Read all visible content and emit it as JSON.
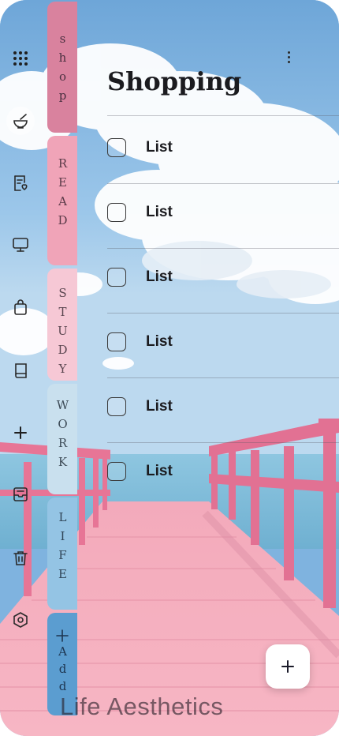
{
  "rail": {
    "items": [
      {
        "name": "apps-grid-icon"
      },
      {
        "name": "mortar-pestle-icon"
      },
      {
        "name": "reading-list-icon"
      },
      {
        "name": "monitor-icon"
      },
      {
        "name": "shopping-bag-icon"
      },
      {
        "name": "book-icon"
      },
      {
        "name": "add-icon"
      },
      {
        "name": "inbox-icon"
      },
      {
        "name": "trash-icon"
      },
      {
        "name": "settings-hexagon-icon"
      }
    ]
  },
  "tabs": [
    {
      "label": "shop",
      "color": "#d9829e"
    },
    {
      "label": "READ",
      "color": "#f0a4b8"
    },
    {
      "label": "STUDY",
      "color": "#f6c8d5"
    },
    {
      "label": "WORK",
      "color": "#c9e0ee"
    },
    {
      "label": "LIFE",
      "color": "#94c4e4"
    },
    {
      "label": "Add",
      "color": "#5b9dd0"
    }
  ],
  "header": {
    "title": "Shopping"
  },
  "list": {
    "items": [
      {
        "label": "List",
        "checked": false
      },
      {
        "label": "List",
        "checked": false
      },
      {
        "label": "List",
        "checked": false
      },
      {
        "label": "List",
        "checked": false
      },
      {
        "label": "List",
        "checked": false
      },
      {
        "label": "List",
        "checked": false
      }
    ]
  },
  "fab": {
    "icon": "plus-icon"
  },
  "footer": {
    "brand": "Life Aesthetics"
  }
}
